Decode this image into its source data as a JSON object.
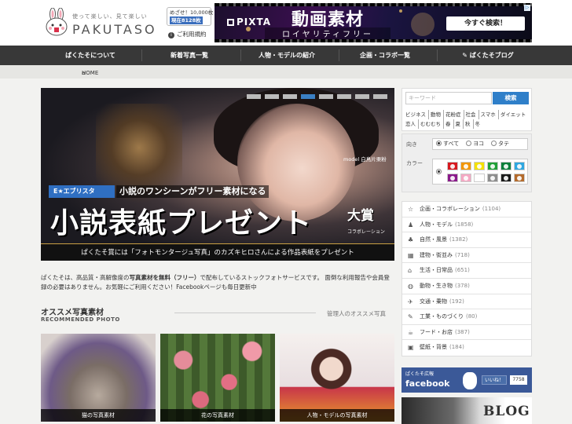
{
  "header": {
    "logo_tagline": "使って楽しい、見て楽しい",
    "logo_brand": "PAKUTASO",
    "counter_line1": "めざせ！10,000枚",
    "counter_line2": "現在8128枚",
    "rules_link": "ご利用規約"
  },
  "ad": {
    "brand": "PIXTA",
    "title": "動画素材",
    "subtitle": "ロイヤリティフリー",
    "cta": "今すぐ検索！"
  },
  "nav": {
    "items": [
      "ぱくたそについて",
      "新着写真一覧",
      "人物・モデルの紹介",
      "企画・コラボ一覧",
      "ぱくたそブログ"
    ]
  },
  "breadcrumb": {
    "home": "HOME"
  },
  "hero": {
    "model_credit": "model 白鳥片栗粉",
    "brand_tag": "E★エブリスタ",
    "headline": "小説のワンシーンがフリー素材になる",
    "big_title": "小説表紙プレゼント",
    "award": "大賞",
    "collab": "コラボレーション",
    "bottom": "ぱくたそ賞には「フォトモンタージュ写真」のカズキヒロさんによる作品表紙をプレゼント"
  },
  "intro": {
    "part1": "ぱくたそは、高品質・高解像度の",
    "bold": "写真素材を無料（フリー）",
    "part2": "で配布しているストックフォトサービスです。 面倒な利用報告や会員登録の必要はありません。お気軽にご利用ください！Facebookページも毎日更新中"
  },
  "recommended": {
    "title": "オススメ写真素材",
    "subtitle": "RECOMMENDED PHOTO",
    "admin": "管理人のオススメ写真",
    "thumbs": [
      {
        "caption": "猫の写真素材"
      },
      {
        "caption": "花の写真素材"
      },
      {
        "caption": "人物・モデルの写真素材"
      }
    ]
  },
  "search": {
    "placeholder": "キーワード",
    "button": "検索",
    "tags": [
      "ビジネス",
      "動物",
      "花粉症",
      "社会",
      "スマホ",
      "ダイエット",
      "恋人",
      "むむむち",
      "春",
      "夏",
      "秋",
      "冬"
    ]
  },
  "filters": {
    "orientation_label": "向き",
    "orientation_options": [
      "すべて",
      "ヨコ",
      "タテ"
    ],
    "color_label": "カラー",
    "colors": [
      "#d71920",
      "#f29600",
      "#f4e100",
      "#21a038",
      "#0a7f3b",
      "#2fa7e0",
      "#8a1a8a",
      "#f4a8c3",
      "#ffffff",
      "#8d8d8d",
      "#1a1a1a",
      "#b46b2c"
    ]
  },
  "categories": [
    {
      "icon": "☆",
      "label": "企画・コラボレーション",
      "count": "(1104)"
    },
    {
      "icon": "♟",
      "label": "人物・モデル",
      "count": "(1858)"
    },
    {
      "icon": "♣",
      "label": "自然・風景",
      "count": "(1382)"
    },
    {
      "icon": "▦",
      "label": "建物・街並み",
      "count": "(718)"
    },
    {
      "icon": "⌂",
      "label": "生活・日常品",
      "count": "(651)"
    },
    {
      "icon": "◍",
      "label": "動物・生き物",
      "count": "(378)"
    },
    {
      "icon": "✈",
      "label": "交通・乗物",
      "count": "(192)"
    },
    {
      "icon": "✎",
      "label": "工業・ものづくり",
      "count": "(80)"
    },
    {
      "icon": "☕",
      "label": "フード・お店",
      "count": "(387)"
    },
    {
      "icon": "▣",
      "label": "壁紙・背景",
      "count": "(184)"
    }
  ],
  "facebook": {
    "line1": "ぱくたそ広報",
    "word": "facebook",
    "like": "いいね！",
    "count": "7758"
  },
  "blog": {
    "label": "BLOG"
  }
}
